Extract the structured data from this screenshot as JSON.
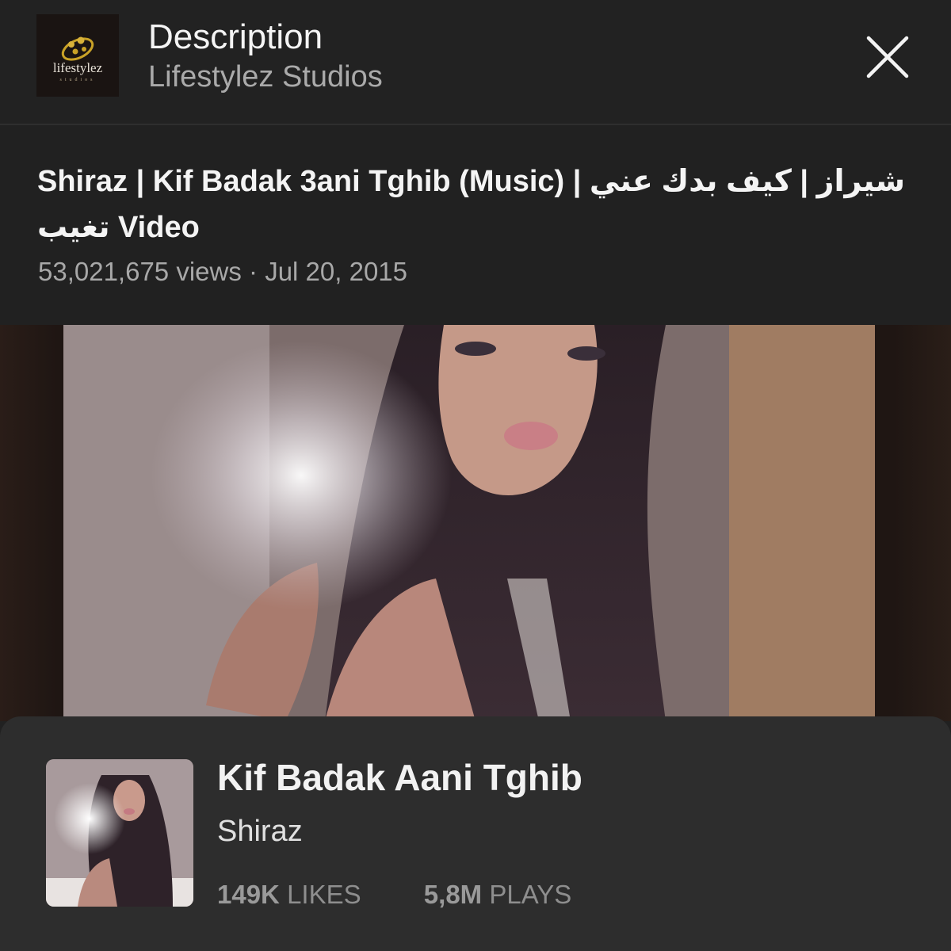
{
  "header": {
    "title": "Description",
    "channel": "Lifestylez Studios",
    "logo_text": "lifestylez",
    "logo_subtext": "studios",
    "close_icon": "close-icon"
  },
  "video": {
    "title": "Shiraz | Kif Badak 3ani Tghib (Music) | شيراز | كيف بدك عني تغيب Video",
    "views": "53,021,675 views",
    "separator": "·",
    "date": "Jul 20, 2015"
  },
  "music_card": {
    "track": "Kif Badak Aani Tghib",
    "artist": "Shiraz",
    "likes_count": "149K",
    "likes_label": "LIKES",
    "plays_count": "5,8M",
    "plays_label": "PLAYS"
  },
  "colors": {
    "background": "#212121",
    "card": "#2d2d2d",
    "secondary_text": "#aaaaaa",
    "logo_gold": "#c9a227"
  }
}
